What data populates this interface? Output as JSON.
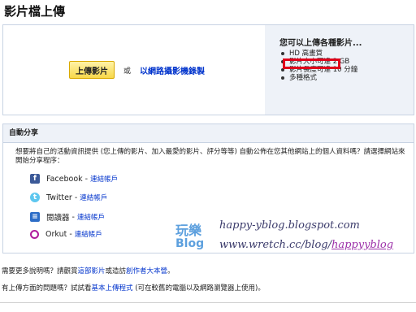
{
  "page": {
    "title": "影片檔上傳"
  },
  "upload": {
    "button_label": "上傳影片",
    "or_text": "或",
    "webcam_link": "以網路攝影機錄製"
  },
  "features": {
    "heading": "您可以上傳各種影片...",
    "items": [
      "HD 高畫質",
      "影片大小可達 2 GB",
      "影片長度可達 10 分鐘",
      "多種格式"
    ]
  },
  "autoshare": {
    "header": "自動分享",
    "description": "想要將自己的活動資訊提供 (您上傳的影片、加入最愛的影片、評分等等) 自動公佈在您其他網站上的個人資料嗎？請選擇網站來開始分享程序：",
    "services": [
      {
        "name": "Facebook",
        "sep": "-",
        "link": "連結帳戶"
      },
      {
        "name": "Twitter",
        "sep": "-",
        "link": "連結帳戶"
      },
      {
        "name": "閱讀器",
        "sep": "-",
        "link": "連結帳戶"
      },
      {
        "name": "Orkut",
        "sep": "-",
        "link": "連結帳戶"
      }
    ]
  },
  "watermark": {
    "cn": "玩樂",
    "blog": "Blog",
    "url1": "happy-yblog.blogspot.com",
    "url2_prefix": "www.wretch.cc/blog/",
    "url2_highlight": "happyyblog"
  },
  "footer": {
    "line1_text": "需要更多說明嗎？請觀賞",
    "line1_link1": "這部影片",
    "line1_mid": "或造訪",
    "line1_link2": "創作者大本營",
    "line1_end": "。",
    "line2_text": "有上傳方面的問題嗎？試試看",
    "line2_link": "基本上傳程式",
    "line2_end": " (可在較舊的電腦以及網路瀏覽器上使用)。"
  },
  "colors": {
    "link": "#0033cc",
    "highlight": "#e0001a",
    "button": "#f7d84a"
  }
}
